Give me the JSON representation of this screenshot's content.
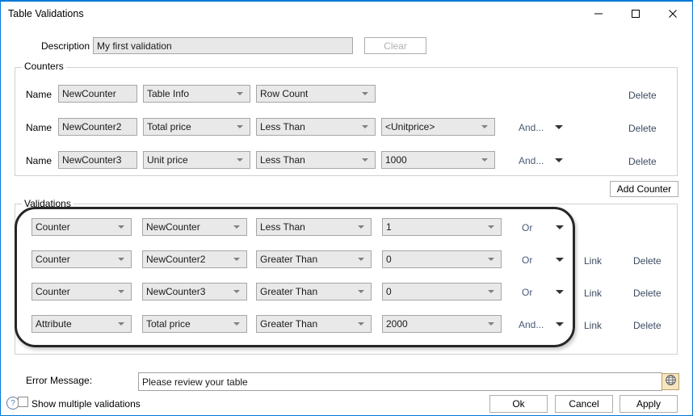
{
  "window": {
    "title": "Table Validations",
    "controls": {
      "minimize": "minimize-icon",
      "maximize": "maximize-icon",
      "close": "close-icon"
    },
    "accent_color": "#0078d7"
  },
  "description": {
    "label": "Description",
    "value": "My first validation",
    "clear_label": "Clear"
  },
  "counters": {
    "group_title": "Counters",
    "name_label": "Name",
    "delete_label": "Delete",
    "add_button": "Add Counter",
    "rows": [
      {
        "name": "NewCounter",
        "source": "Table Info",
        "operator": "Row Count",
        "value": "",
        "conjunction": "",
        "has_value": false,
        "has_conjunction": false,
        "delete": "Delete"
      },
      {
        "name": "NewCounter2",
        "source": "Total price",
        "operator": "Less Than",
        "value": "<Unitprice>",
        "conjunction": "And...",
        "has_value": true,
        "has_conjunction": true,
        "delete": "Delete"
      },
      {
        "name": "NewCounter3",
        "source": "Unit price",
        "operator": "Less Than",
        "value": "1000",
        "conjunction": "And...",
        "has_value": true,
        "has_conjunction": true,
        "delete": "Delete"
      }
    ]
  },
  "validations": {
    "group_title": "Validations",
    "link_label": "Link",
    "delete_label": "Delete",
    "rows": [
      {
        "type": "Counter",
        "target": "NewCounter",
        "operator": "Less Than",
        "value": "1",
        "conjunction": "Or",
        "link": "",
        "delete": "",
        "has_actions": false
      },
      {
        "type": "Counter",
        "target": "NewCounter2",
        "operator": "Greater Than",
        "value": "0",
        "conjunction": "Or",
        "link": "Link",
        "delete": "Delete",
        "has_actions": true
      },
      {
        "type": "Counter",
        "target": "NewCounter3",
        "operator": "Greater Than",
        "value": "0",
        "conjunction": "Or",
        "link": "Link",
        "delete": "Delete",
        "has_actions": true
      },
      {
        "type": "Attribute",
        "target": "Total price",
        "operator": "Greater Than",
        "value": "2000",
        "conjunction": "And...",
        "link": "Link",
        "delete": "Delete",
        "has_actions": true
      }
    ]
  },
  "error_message": {
    "label": "Error Message:",
    "value": "Please review your table",
    "globe_icon": "globe-icon"
  },
  "footer": {
    "help_icon": "help-question-icon",
    "show_multiple_label": "Show multiple validations",
    "show_multiple_checked": false,
    "ok_label": "Ok",
    "cancel_label": "Cancel",
    "apply_label": "Apply"
  }
}
